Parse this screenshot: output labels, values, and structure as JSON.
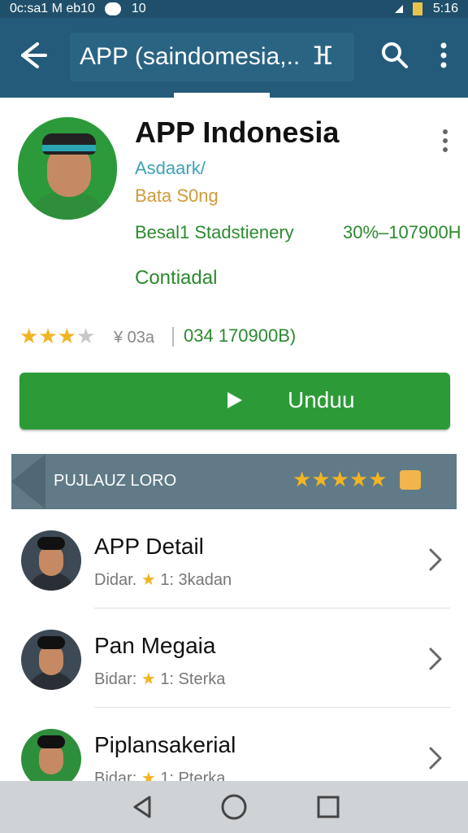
{
  "status_bar": {
    "left": "0c:sa1 M eb10",
    "badge": "10",
    "time": "5:16"
  },
  "app_bar": {
    "title": "APP  (saindomesia,..",
    "title_suffix": "ⴼ",
    "icons": [
      "back-arrow-icon",
      "search-icon",
      "overflow-menu-icon"
    ]
  },
  "app": {
    "name": "APP Indonesia",
    "developer": "Asdaark/",
    "subtitle": "Bata S0ng",
    "category": "Besal1 Stadstienery",
    "size": "30%–107900H",
    "contact": "Contiadal",
    "rating_stars": 3.5,
    "rating_text": "¥ 03a",
    "downloads": "034 170900B)"
  },
  "install_button": {
    "label": "Unduu"
  },
  "section": {
    "label": "PUJLAUZ LORO",
    "stars": "★★★★★"
  },
  "list": [
    {
      "title": "APP Detail",
      "meta_prefix": "Didar.",
      "meta_star": "★",
      "meta_suffix": "1: 3kadan"
    },
    {
      "title": "Pan Megaia",
      "meta_prefix": "Bidar:",
      "meta_star": "★",
      "meta_suffix": "1: Sterka"
    },
    {
      "title": "Piplansakerial",
      "meta_prefix": "Bidar:",
      "meta_star": "★",
      "meta_suffix": "1: Pterka"
    }
  ],
  "colors": {
    "app_bar": "#245b7a",
    "install": "#2c9b37",
    "section": "#607a87",
    "accent_text": "#2b8a2f"
  }
}
